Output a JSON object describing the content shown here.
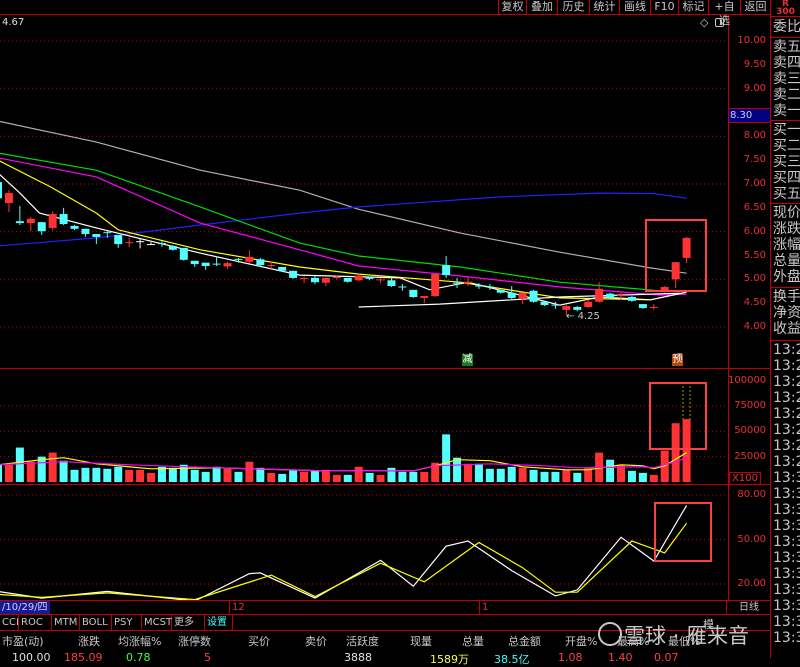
{
  "toolbar": {
    "buttons": [
      "复权",
      "叠加",
      "历史",
      "统计",
      "画线",
      "F10",
      "标记",
      "+自选",
      "返回"
    ]
  },
  "top_right": {
    "line1": "R",
    "line2": "300"
  },
  "price_readout": "4.67",
  "chart_icons": [
    "diamond-icon",
    "window-icon"
  ],
  "price_axis": {
    "ticks": [
      "10.00",
      "9.50",
      "9.00",
      "8.00",
      "7.50",
      "7.00",
      "6.50",
      "6.00",
      "5.50",
      "5.00",
      "4.50",
      "4.00"
    ],
    "last_price": "8.30"
  },
  "volume_axis": {
    "ticks": [
      "100000",
      "75000",
      "50000",
      "25000"
    ],
    "unit": "X100"
  },
  "kdj_axis": {
    "ticks": [
      "80.00",
      "50.00",
      "20.00"
    ]
  },
  "annotations": {
    "low_label": "4.25",
    "marker_reduce": "减",
    "marker_forecast": "预"
  },
  "colors": {
    "up": "#ff3333",
    "down": "#54ffff",
    "grid": "#c00000",
    "ma_white": "#ffffff",
    "ma_yellow": "#ffff00",
    "ma_magenta": "#ff00ff",
    "ma_green": "#00dd00",
    "ma_gray": "#b0b0b0",
    "ma_blue": "#2020ff",
    "highlight_box": "#ff4040"
  },
  "chart_data": [
    {
      "type": "candlestick",
      "ylim": [
        4.0,
        10.0
      ],
      "grid": true,
      "candles": [
        [
          7.04,
          6.7,
          7.1,
          6.65
        ],
        [
          6.6,
          6.81,
          6.87,
          6.41
        ],
        [
          6.22,
          6.18,
          6.54,
          6.14
        ],
        [
          6.18,
          6.27,
          6.31,
          6.01
        ],
        [
          6.2,
          6.01,
          6.2,
          5.93
        ],
        [
          6.08,
          6.37,
          6.43,
          6.03
        ],
        [
          6.37,
          6.16,
          6.5,
          6.14
        ],
        [
          6.12,
          6.06,
          6.14,
          6.03
        ],
        [
          6.06,
          5.95,
          6.06,
          5.89
        ],
        [
          5.95,
          5.89,
          5.95,
          5.74
        ],
        [
          5.99,
          5.97,
          6.01,
          5.87
        ],
        [
          5.93,
          5.74,
          5.93,
          5.66
        ],
        [
          5.76,
          5.78,
          5.87,
          5.68
        ],
        [
          5.8,
          5.8,
          5.85,
          5.65
        ],
        [
          5.74,
          5.74,
          5.78,
          5.72
        ],
        [
          5.76,
          5.74,
          5.8,
          5.68
        ],
        [
          5.7,
          5.62,
          5.72,
          5.6
        ],
        [
          5.66,
          5.41,
          5.66,
          5.39
        ],
        [
          5.39,
          5.32,
          5.39,
          5.26
        ],
        [
          5.35,
          5.28,
          5.35,
          5.2
        ],
        [
          5.33,
          5.31,
          5.49,
          5.28
        ],
        [
          5.27,
          5.34,
          5.37,
          5.22
        ],
        [
          5.43,
          5.41,
          5.45,
          5.35
        ],
        [
          5.37,
          5.47,
          5.61,
          5.33
        ],
        [
          5.42,
          5.3,
          5.45,
          5.27
        ],
        [
          5.29,
          5.3,
          5.37,
          5.22
        ],
        [
          5.26,
          5.18,
          5.26,
          5.16
        ],
        [
          5.18,
          5.03,
          5.18,
          5.01
        ],
        [
          5.02,
          5.03,
          5.06,
          4.92
        ],
        [
          5.03,
          4.94,
          5.08,
          4.9
        ],
        [
          4.93,
          5.03,
          5.03,
          4.86
        ],
        [
          5.04,
          5.05,
          5.08,
          5.0
        ],
        [
          5.03,
          4.95,
          5.03,
          4.93
        ],
        [
          4.98,
          5.08,
          5.1,
          4.96
        ],
        [
          5.05,
          5.01,
          5.06,
          4.98
        ],
        [
          4.98,
          5.0,
          5.03,
          4.92
        ],
        [
          4.98,
          4.86,
          5.06,
          4.84
        ],
        [
          4.85,
          4.83,
          4.9,
          4.76
        ],
        [
          4.78,
          4.63,
          4.78,
          4.61
        ],
        [
          4.61,
          4.65,
          4.65,
          4.5
        ],
        [
          4.65,
          5.11,
          5.12,
          4.63
        ],
        [
          5.3,
          5.09,
          5.49,
          5.03
        ],
        [
          4.93,
          4.91,
          5.03,
          4.82
        ],
        [
          4.92,
          4.95,
          5.05,
          4.86
        ],
        [
          4.87,
          4.85,
          4.92,
          4.8
        ],
        [
          4.85,
          4.83,
          4.9,
          4.78
        ],
        [
          4.78,
          4.72,
          4.78,
          4.7
        ],
        [
          4.72,
          4.61,
          4.86,
          4.59
        ],
        [
          4.59,
          4.72,
          4.72,
          4.48
        ],
        [
          4.76,
          4.53,
          4.78,
          4.51
        ],
        [
          4.53,
          4.46,
          4.53,
          4.44
        ],
        [
          4.47,
          4.46,
          4.53,
          4.38
        ],
        [
          4.36,
          4.44,
          4.46,
          4.25
        ],
        [
          4.42,
          4.36,
          4.44,
          4.33
        ],
        [
          4.42,
          4.53,
          4.57,
          4.4
        ],
        [
          4.53,
          4.8,
          4.94,
          4.51
        ],
        [
          4.7,
          4.61,
          4.72,
          4.59
        ],
        [
          4.65,
          4.67,
          4.72,
          4.57
        ],
        [
          4.63,
          4.55,
          4.65,
          4.53
        ],
        [
          4.48,
          4.4,
          4.48,
          4.38
        ],
        [
          4.41,
          4.42,
          4.48,
          4.36
        ],
        [
          4.74,
          4.84,
          4.86,
          4.72
        ],
        [
          5.0,
          5.36,
          5.36,
          4.82
        ],
        [
          5.45,
          5.87,
          5.89,
          5.34
        ]
      ],
      "lines": [
        {
          "color": "#b0b0b0",
          "points": [
            [
              0,
              8.32
            ],
            [
              9,
              7.88
            ],
            [
              18.5,
              7.29
            ],
            [
              27.6,
              6.87
            ],
            [
              33,
              6.47
            ],
            [
              42.3,
              5.97
            ],
            [
              51.4,
              5.57
            ],
            [
              59.7,
              5.24
            ],
            [
              63,
              5.13
            ]
          ]
        },
        {
          "color": "#2020ff",
          "points": [
            [
              0,
              5.7
            ],
            [
              9,
              5.87
            ],
            [
              18.5,
              6.14
            ],
            [
              27.6,
              6.39
            ],
            [
              33,
              6.52
            ],
            [
              45.9,
              6.73
            ],
            [
              55,
              6.81
            ],
            [
              60,
              6.8
            ],
            [
              63,
              6.7
            ]
          ]
        },
        {
          "color": "#00dd00",
          "points": [
            [
              0,
              7.65
            ],
            [
              9,
              7.29
            ],
            [
              18.5,
              6.52
            ],
            [
              27.6,
              5.76
            ],
            [
              33,
              5.49
            ],
            [
              42.3,
              5.26
            ],
            [
              51.4,
              4.94
            ],
            [
              60.6,
              4.76
            ],
            [
              63,
              4.76
            ]
          ]
        },
        {
          "color": "#ff00ff",
          "points": [
            [
              0,
              7.55
            ],
            [
              9,
              7.15
            ],
            [
              18.5,
              6.18
            ],
            [
              27.6,
              5.62
            ],
            [
              33,
              5.28
            ],
            [
              42.3,
              5.07
            ],
            [
              51.4,
              4.84
            ],
            [
              60.6,
              4.67
            ],
            [
              63,
              4.69
            ]
          ]
        },
        {
          "color": "#ffff00",
          "points": [
            [
              0,
              7.5
            ],
            [
              4.8,
              6.94
            ],
            [
              9,
              6.39
            ],
            [
              11,
              6.04
            ],
            [
              18.5,
              5.62
            ],
            [
              27.6,
              5.26
            ],
            [
              33,
              5.11
            ],
            [
              42.3,
              4.94
            ],
            [
              51.4,
              4.61
            ],
            [
              59.7,
              4.57
            ],
            [
              63,
              4.73
            ]
          ]
        },
        {
          "color": "#ffffff",
          "points": [
            [
              0,
              7.23
            ],
            [
              2,
              6.81
            ],
            [
              3.8,
              6.39
            ],
            [
              9,
              6.08
            ],
            [
              18.5,
              5.55
            ],
            [
              27.6,
              5.09
            ],
            [
              36.8,
              5.03
            ],
            [
              39.5,
              4.78
            ],
            [
              43,
              4.94
            ],
            [
              51.4,
              4.46
            ],
            [
              55,
              4.63
            ],
            [
              59.7,
              4.57
            ],
            [
              63,
              4.73
            ]
          ]
        },
        {
          "color": "#ffffff",
          "points": [
            [
              33,
              4.42
            ],
            [
              40.4,
              4.48
            ],
            [
              51.4,
              4.63
            ],
            [
              62.4,
              4.71
            ]
          ]
        }
      ]
    },
    {
      "type": "bar",
      "ylim": [
        0,
        100000
      ],
      "values": [
        17000,
        17000,
        34000,
        20000,
        25000,
        29000,
        21000,
        12000,
        14000,
        14000,
        13000,
        15000,
        12000,
        12000,
        9000,
        15000,
        14000,
        17000,
        12000,
        10000,
        15000,
        13000,
        10000,
        20000,
        14000,
        9000,
        8000,
        12000,
        10000,
        11000,
        12000,
        7000,
        7000,
        15000,
        9000,
        7000,
        14000,
        10000,
        10000,
        10000,
        19000,
        47000,
        24000,
        18000,
        18000,
        13000,
        13000,
        15000,
        14000,
        12000,
        10000,
        10000,
        12000,
        9000,
        14000,
        29000,
        22000,
        17000,
        11000,
        9000,
        7000,
        31000,
        58000,
        62000
      ],
      "lines": [
        {
          "color": "#ffff00",
          "points": [
            [
              0,
              17000
            ],
            [
              4,
              22000
            ],
            [
              6,
              24000
            ],
            [
              9,
              18000
            ],
            [
              14,
              13000
            ],
            [
              20,
              14000
            ],
            [
              30,
              11000
            ],
            [
              38,
              11000
            ],
            [
              40,
              16000
            ],
            [
              42,
              22000
            ],
            [
              45,
              21000
            ],
            [
              48,
              15000
            ],
            [
              52,
              12000
            ],
            [
              54,
              12000
            ],
            [
              57,
              17000
            ],
            [
              59,
              16000
            ],
            [
              60,
              13000
            ],
            [
              61,
              16000
            ],
            [
              63,
              29000
            ]
          ]
        },
        {
          "color": "#ff00ff",
          "points": [
            [
              0,
              17000
            ],
            [
              6,
              20000
            ],
            [
              12,
              17000
            ],
            [
              20,
              14000
            ],
            [
              30,
              11000
            ],
            [
              38,
              11000
            ],
            [
              40,
              16000
            ],
            [
              45,
              18000
            ],
            [
              50,
              16000
            ],
            [
              53,
              14000
            ],
            [
              59,
              15000
            ],
            [
              60,
              14000
            ],
            [
              62,
              20000
            ],
            [
              63,
              24000
            ]
          ]
        }
      ]
    },
    {
      "type": "line",
      "ylim": [
        0,
        100
      ],
      "series": [
        {
          "color": "#ffffff",
          "points": [
            [
              0,
              15
            ],
            [
              4,
              10.5
            ],
            [
              10,
              15
            ],
            [
              18,
              8.5
            ],
            [
              23,
              27
            ],
            [
              24,
              27.5
            ],
            [
              29,
              10.5
            ],
            [
              35,
              36
            ],
            [
              38,
              18.5
            ],
            [
              41,
              45.5
            ],
            [
              43,
              49
            ],
            [
              47,
              29
            ],
            [
              51,
              12
            ],
            [
              53,
              16
            ],
            [
              57,
              51.5
            ],
            [
              60,
              35.5
            ],
            [
              63,
              73
            ]
          ]
        },
        {
          "color": "#ffff00",
          "points": [
            [
              0,
              13
            ],
            [
              4,
              11
            ],
            [
              10,
              14
            ],
            [
              18,
              9.5
            ],
            [
              25,
              26
            ],
            [
              29,
              11.5
            ],
            [
              35,
              34
            ],
            [
              39,
              21.5
            ],
            [
              44,
              48
            ],
            [
              48,
              31
            ],
            [
              51,
              14.5
            ],
            [
              53,
              14.5
            ],
            [
              58,
              49
            ],
            [
              61,
              41
            ],
            [
              63,
              61
            ]
          ]
        }
      ]
    }
  ],
  "date_axis": {
    "current": "/10/29/四",
    "ticks": [
      "12",
      "1"
    ],
    "period": "日线"
  },
  "indicator_tabs": [
    "CCI",
    "ROC",
    "MTM",
    "BOLL",
    "PSY",
    "MCST",
    "更多",
    "设置"
  ],
  "right_panel": {
    "top_label": "委比",
    "sell": [
      "卖五",
      "卖四",
      "卖三",
      "卖二",
      "卖一"
    ],
    "buy": [
      "买一",
      "买二",
      "买三",
      "买四",
      "买五"
    ],
    "quote": [
      "现价",
      "涨跌",
      "涨幅",
      "总量",
      "外盘"
    ],
    "fund": [
      "换手",
      "净资",
      "收益"
    ],
    "times": [
      "13:29",
      "13:29",
      "13:29",
      "13:29",
      "13:29",
      "13:29",
      "13:29",
      "13:29",
      "13:30",
      "13:30",
      "13:30",
      "13:30",
      "13:30",
      "13:30",
      "13:30",
      "13:30",
      "13:30",
      "13:30",
      "13:30"
    ]
  },
  "table": {
    "headers": [
      "市盈(动)",
      "涨跌",
      "均涨幅%",
      "涨停数",
      "买价",
      "卖价",
      "活跃度",
      "现量",
      "总量",
      "总金额",
      "开盘%",
      "最高%",
      "最低%"
    ],
    "values": [
      "100.00",
      "185.09",
      "0.78",
      "5",
      "",
      "",
      "3888",
      "1589万",
      "38.5亿",
      "1.08",
      "1.40",
      "0.07"
    ]
  },
  "watermark": "雪球 · 雁来音",
  "side_label": "模"
}
